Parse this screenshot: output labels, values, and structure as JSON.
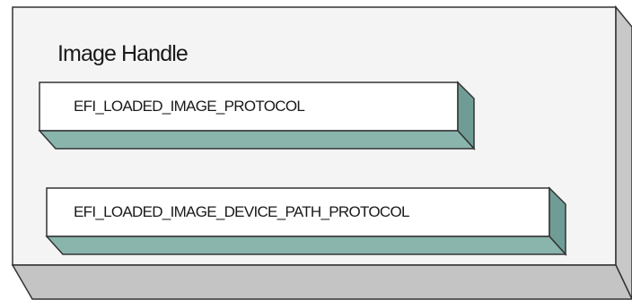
{
  "handle": {
    "title": "Image Handle",
    "protocols": [
      {
        "label": "EFI_LOADED_IMAGE_PROTOCOL"
      },
      {
        "label": "EFI_LOADED_IMAGE_DEVICE_PATH_PROTOCOL"
      }
    ]
  },
  "colors": {
    "outer_face": "#f4f4f4",
    "outer_side": "#c8c8c8",
    "outer_bottom": "#c4c4c4",
    "protocol_face": "#ffffff",
    "protocol_side": "#6f9d95",
    "protocol_bottom": "#89b5ad",
    "stroke": "#333333"
  }
}
